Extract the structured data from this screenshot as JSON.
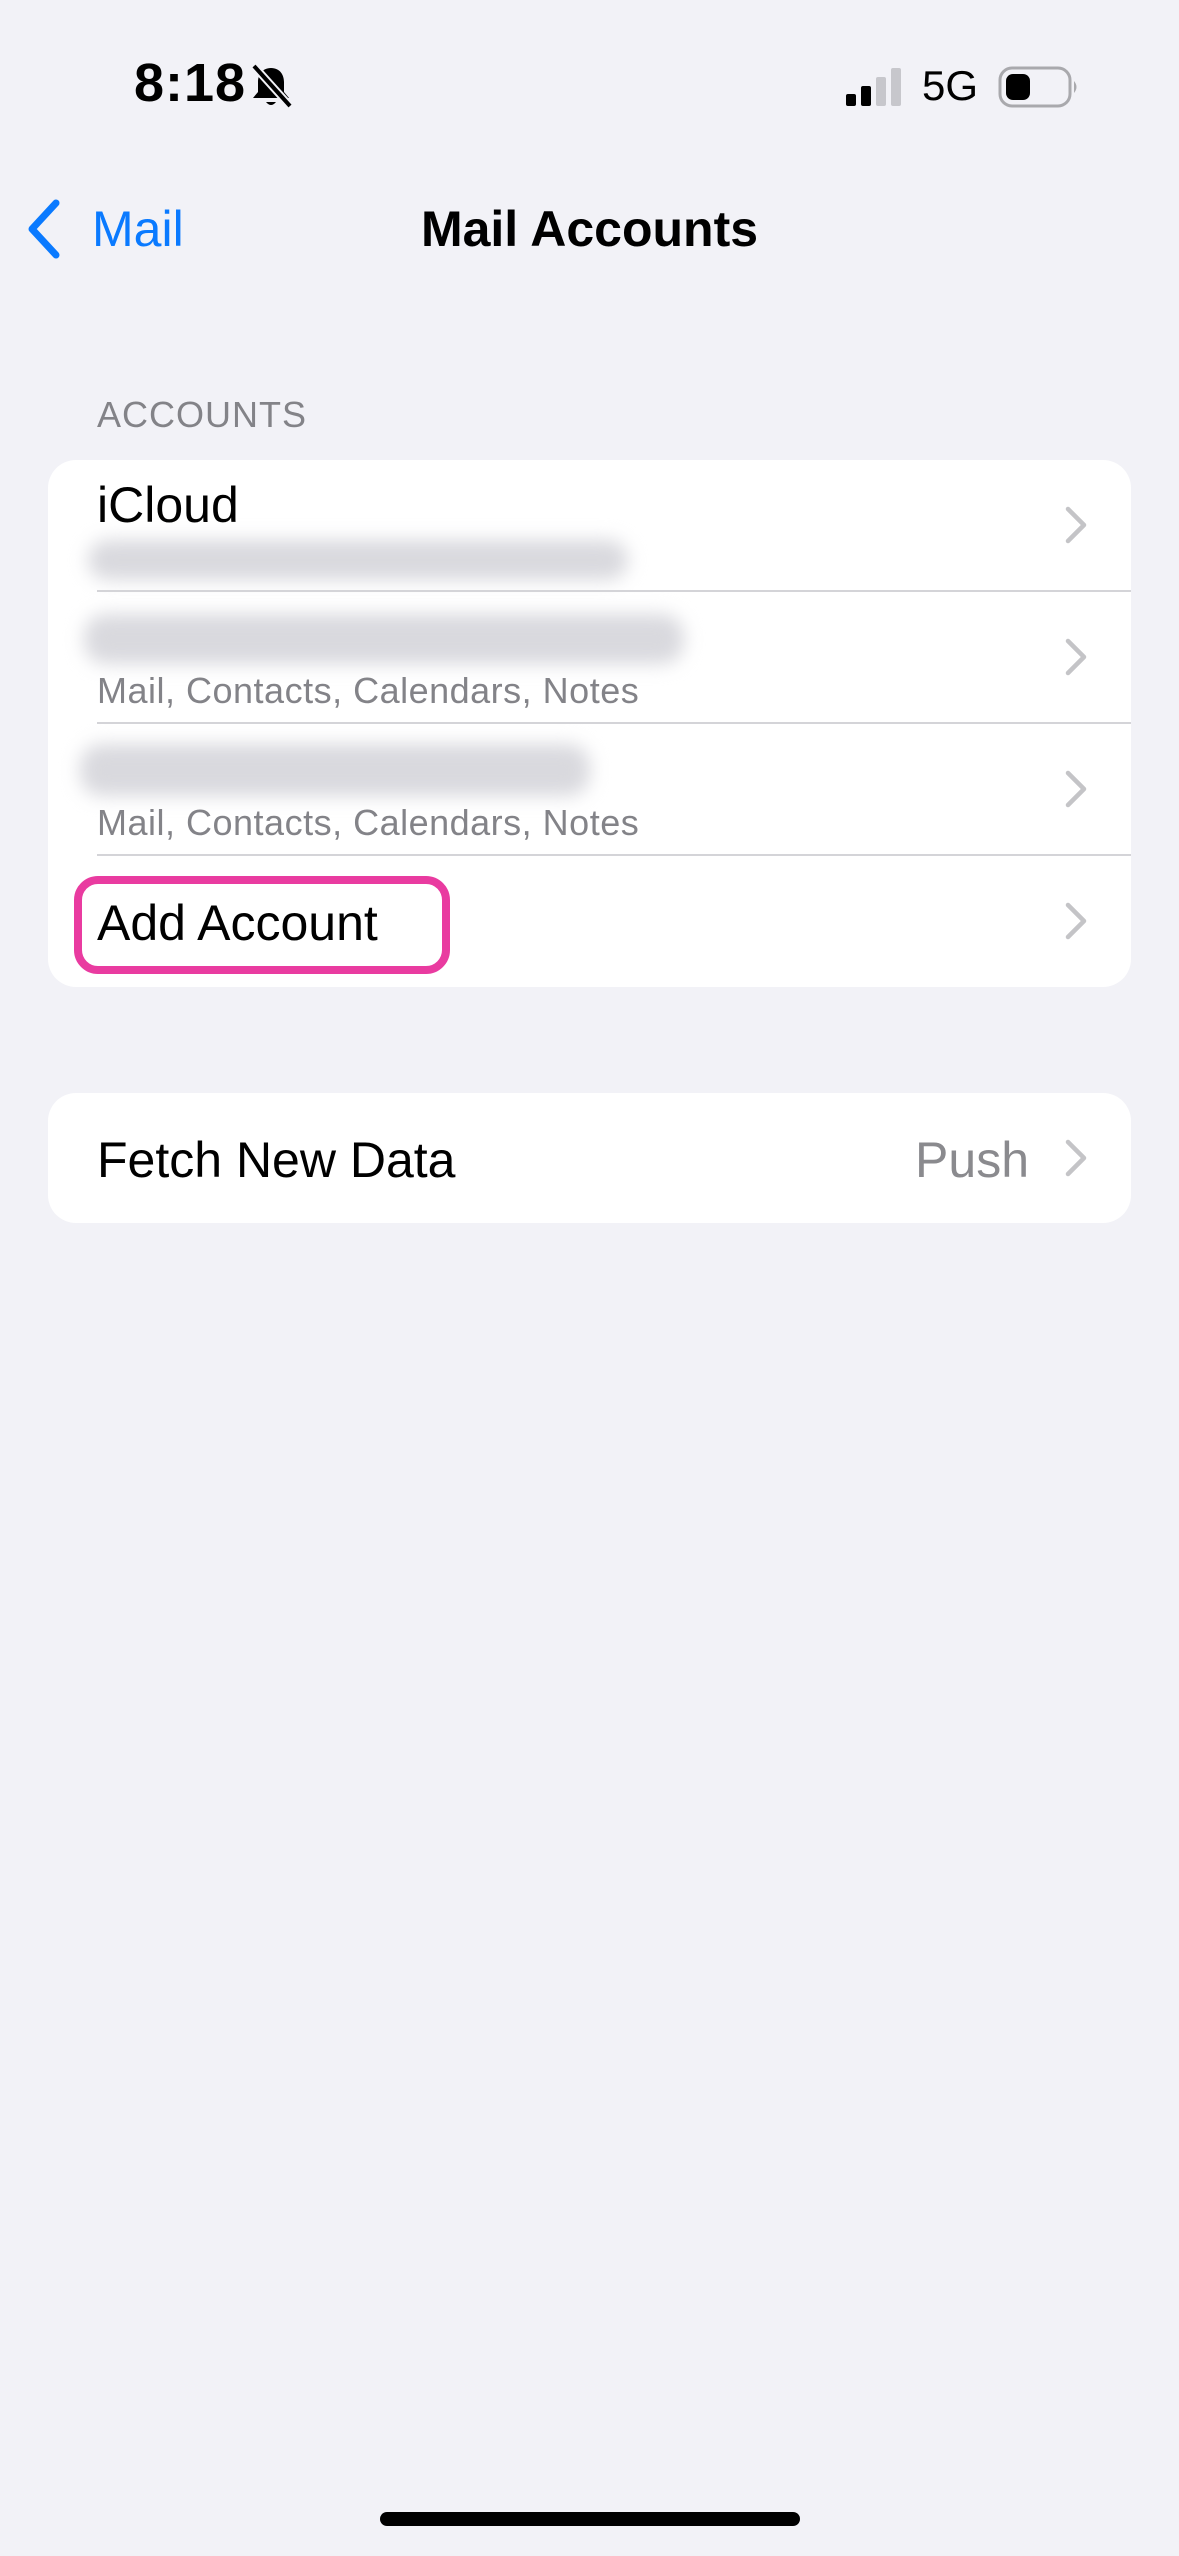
{
  "status_bar": {
    "time": "8:18",
    "network": "5G",
    "icons": [
      "bell-slash-icon",
      "cellular-signal-icon",
      "battery-icon"
    ]
  },
  "nav": {
    "back_label": "Mail",
    "title": "Mail Accounts"
  },
  "accounts_section": {
    "header": "ACCOUNTS",
    "rows": [
      {
        "title": "iCloud",
        "subtitle": ""
      },
      {
        "title": "",
        "subtitle": "Mail, Contacts, Calendars, Notes"
      },
      {
        "title": "",
        "subtitle": "Mail, Contacts, Calendars, Notes"
      },
      {
        "title": "Add Account",
        "subtitle": ""
      }
    ]
  },
  "settings_section": {
    "fetch_label": "Fetch New Data",
    "fetch_value": "Push"
  },
  "colors": {
    "accent": "#0a7aff",
    "highlight": "#e93ba0",
    "background": "#f2f2f7",
    "secondary_text": "#838388"
  }
}
